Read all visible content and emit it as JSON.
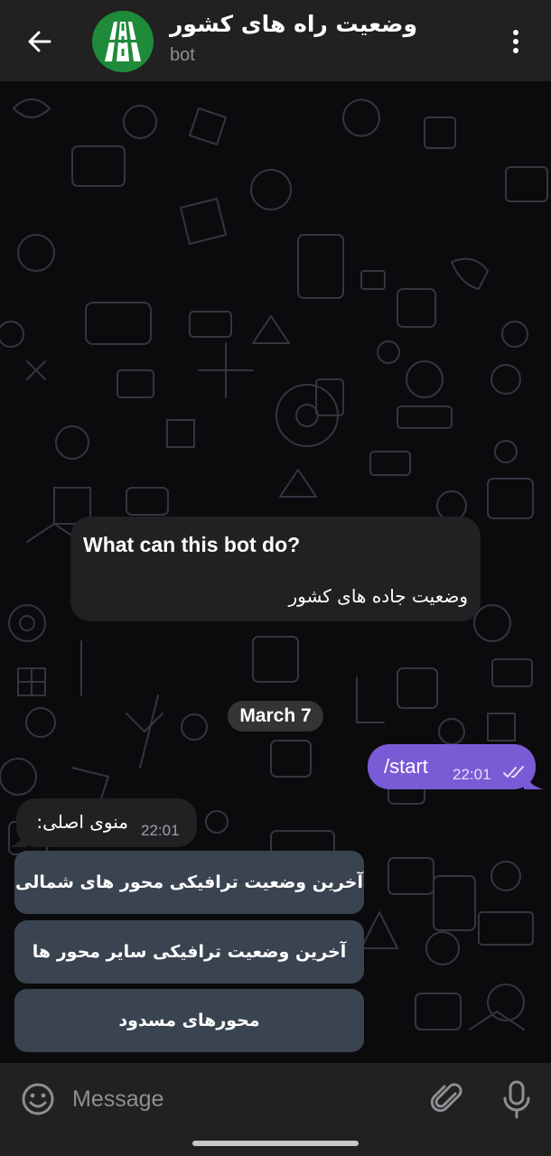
{
  "header": {
    "title": "وضعیت راه های کشور",
    "subtitle": "bot",
    "back_icon": "arrow-left-icon",
    "menu_icon": "more-vertical-icon",
    "avatar_color": "#1a7f34"
  },
  "chat": {
    "bot_info": {
      "title": "What can this bot do?",
      "description": "وضعیت جاده های کشور"
    },
    "date_label": "March 7",
    "outgoing": {
      "text": "/start",
      "time": "22:01",
      "status_icon": "double-check-icon",
      "bubble_color": "#7a5bd6"
    },
    "incoming": {
      "text": "منوی اصلی:",
      "time": "22:01"
    },
    "keyboard": [
      "آخرین وضعیت ترافیکی محور های شمالی",
      "آخرین وضعیت ترافیکی سایر محور ها",
      "محورهای مسدود"
    ]
  },
  "composer": {
    "placeholder": "Message",
    "emoji_icon": "smiley-icon",
    "attach_icon": "paperclip-icon",
    "mic_icon": "microphone-icon"
  }
}
